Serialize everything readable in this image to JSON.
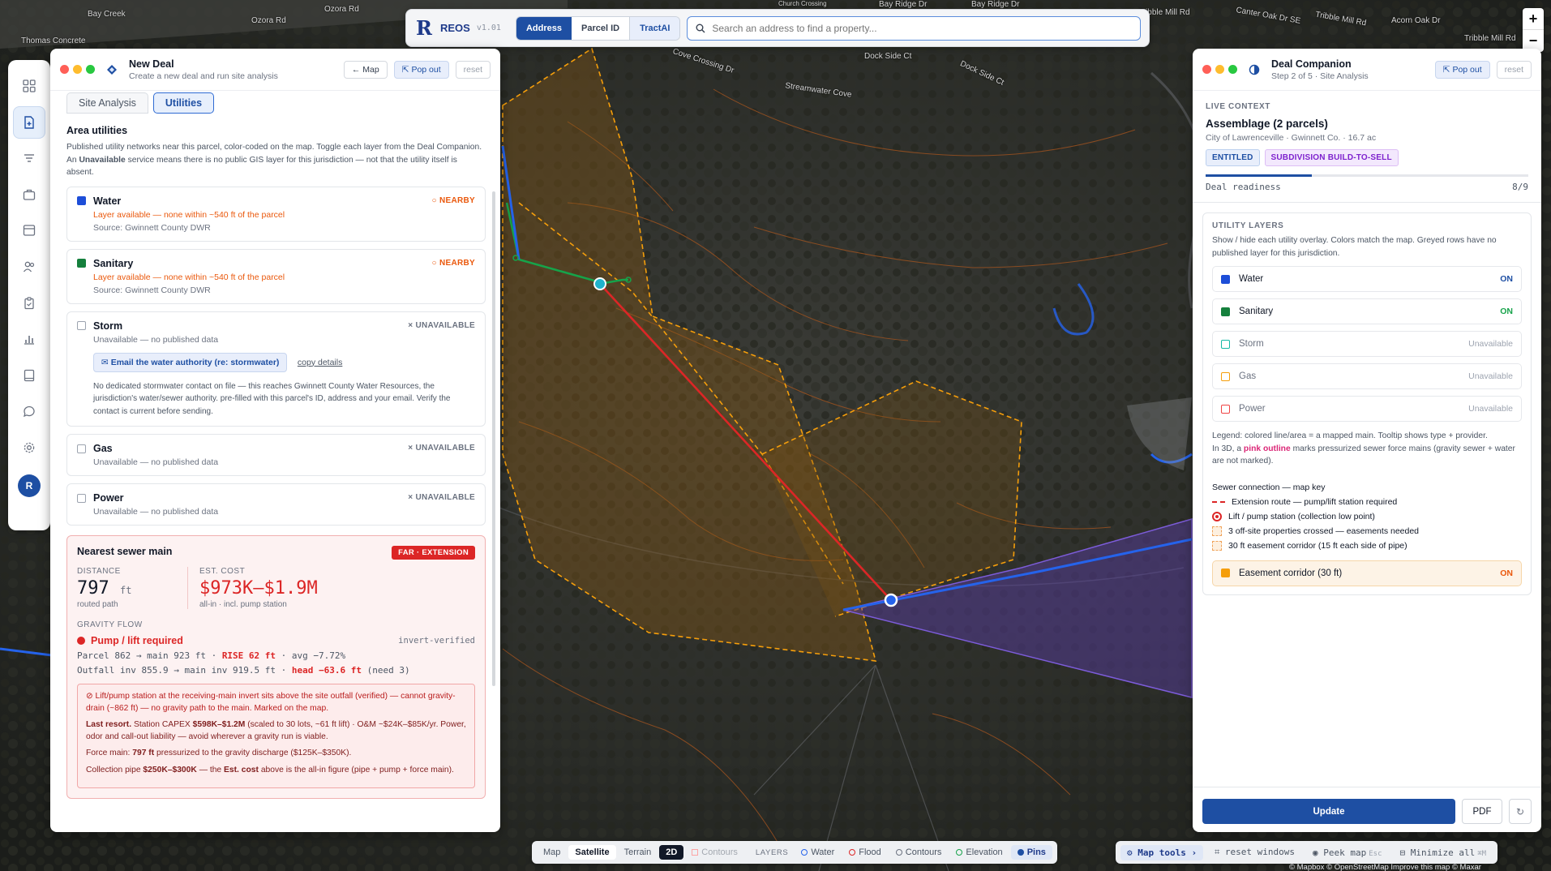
{
  "map": {
    "labels": [
      "Bay Creek",
      "Ozora Rd",
      "Ozora Rd",
      "Thomas Concrete",
      "Cove Crossing Dr",
      "Dock Side Ct",
      "Dock Side Ct",
      "Streamwater Cove",
      "Bay Ridge Dr",
      "Bay Ridge Dr",
      "Tribble Mill Rd",
      "Tribble Mill Rd",
      "Canter Oak Dr SE",
      "Acorn Oak Dr",
      "Tribble Mill Rd",
      "Church Crossing"
    ],
    "zoom_in": "+",
    "zoom_out": "−",
    "attribution": "© Mapbox © OpenStreetMap Improve this map © Maxar"
  },
  "topbar": {
    "logo": "R",
    "brand": "REOS",
    "version": "v1.01",
    "modes": [
      "Address",
      "Parcel ID",
      "TractAI"
    ],
    "search_placeholder": "Search an address to find a property..."
  },
  "rail": {
    "icons": [
      "grid-icon",
      "new-deal-icon",
      "filter-icon",
      "briefcase-icon",
      "inbox-icon",
      "people-icon",
      "clipboard-icon",
      "chart-icon",
      "book-icon",
      "chat-icon",
      "settings-icon"
    ],
    "avatar": "R"
  },
  "left_panel": {
    "title": "New Deal",
    "subtitle": "Create a new deal and run site analysis",
    "map_btn": "← Map",
    "popout_btn": "⇱ Pop out",
    "reset_btn": "reset",
    "tabs": [
      "Site Analysis",
      "Utilities"
    ],
    "section_title": "Area utilities",
    "section_desc_1": "Published utility networks near this parcel, color-coded on the map. Toggle each layer from the Deal Companion. An ",
    "section_desc_bold": "Unavailable",
    "section_desc_2": " service means there is no public GIS layer for this jurisdiction — not that the utility itself is absent.",
    "utilities": [
      {
        "name": "Water",
        "color": "#1d4ed8",
        "tag": "NEARBY",
        "line1": "Layer available — none within ~540 ft of the parcel",
        "line2": "Source: Gwinnett County DWR"
      },
      {
        "name": "Sanitary",
        "color": "#15803d",
        "tag": "NEARBY",
        "line1": "Layer available — none within ~540 ft of the parcel",
        "line2": "Source: Gwinnett County DWR"
      },
      {
        "name": "Storm",
        "tag": "UNAVAILABLE",
        "line1": "Unavailable — no published data",
        "email_btn": "✉ Email the water authority (re: stormwater)",
        "copy_link": "copy details",
        "note": "No dedicated stormwater contact on file — this reaches Gwinnett County Water Resources, the jurisdiction's water/sewer authority. pre-filled with this parcel's ID, address and your email. Verify the contact is current before sending."
      },
      {
        "name": "Gas",
        "tag": "UNAVAILABLE",
        "line1": "Unavailable — no published data"
      },
      {
        "name": "Power",
        "tag": "UNAVAILABLE",
        "line1": "Unavailable — no published data"
      }
    ],
    "sewer": {
      "title": "Nearest sewer main",
      "badge": "FAR · EXTENSION",
      "distance_label": "DISTANCE",
      "distance_value": "797",
      "distance_unit": "ft",
      "distance_sub": "routed path",
      "cost_label": "EST. COST",
      "cost_value": "$973K–$1.9M",
      "cost_sub": "all-in · incl. pump station",
      "gravity_label": "GRAVITY FLOW",
      "gravity_status": "Pump / lift required",
      "gravity_verified": "invert-verified",
      "line1_a": "Parcel 862 → main 923 ft · ",
      "line1_b": "RISE 62 ft",
      "line1_c": " · avg −7.72%",
      "line2_a": "Outfall inv 855.9 → main inv 919.5 ft · ",
      "line2_b": "head −63.6 ft",
      "line2_c": " (need 3)",
      "warn_1": "⊘ Lift/pump station at the receiving-main invert sits above the site outfall (verified) — cannot gravity-drain (~862 ft) — no gravity path to the main. Marked on the map.",
      "warn_2_bold": "Last resort.",
      "warn_2_a": " Station CAPEX ",
      "warn_2_b": "$598K–$1.2M",
      "warn_2_c": " (scaled to 30 lots, ~61 ft lift) · O&M ~$24K–$85K/yr. Power, odor and call-out liability — avoid wherever a gravity run is viable.",
      "warn_3_a": "Force main: ",
      "warn_3_b": "797 ft",
      "warn_3_c": " pressurized to the gravity discharge ($125K–$350K).",
      "warn_4_a": "Collection pipe ",
      "warn_4_b": "$250K–$300K",
      "warn_4_c": " — the ",
      "warn_4_d": "Est. cost",
      "warn_4_e": " above is the all-in figure (pipe + pump + force main)."
    }
  },
  "right_panel": {
    "title": "Deal Companion",
    "subtitle": "Step 2 of 5 · Site Analysis",
    "popout_btn": "⇱ Pop out",
    "reset_btn": "reset",
    "ctx_label": "LIVE CONTEXT",
    "ctx_title": "Assemblage (2 parcels)",
    "ctx_sub": "City of Lawrenceville · Gwinnett Co. · 16.7 ac",
    "pills": [
      "ENTITLED",
      "SUBDIVISION BUILD-TO-SELL"
    ],
    "readiness_label": "Deal readiness",
    "readiness_value": "8/9",
    "readiness_fraction": 0.33,
    "layers_label": "UTILITY LAYERS",
    "layers_desc": "Show / hide each utility overlay. Colors match the map. Greyed rows have no published layer for this jurisdiction.",
    "layers": [
      {
        "name": "Water",
        "color": "#1d4ed8",
        "state": "ON",
        "enabled": true
      },
      {
        "name": "Sanitary",
        "color": "#15803d",
        "state": "ON",
        "enabled": true
      },
      {
        "name": "Storm",
        "color": "#14b8a6",
        "state": "Unavailable",
        "enabled": false
      },
      {
        "name": "Gas",
        "color": "#f59e0b",
        "state": "Unavailable",
        "enabled": false
      },
      {
        "name": "Power",
        "color": "#ef4444",
        "state": "Unavailable",
        "enabled": false
      }
    ],
    "legend_1": "Legend: colored line/area = a mapped main. Tooltip shows type + provider.",
    "legend_2a": "In 3D, a ",
    "legend_2b": "pink outline",
    "legend_2c": " marks pressurized sewer force mains (gravity sewer + water are not marked).",
    "key_title": "Sewer connection — map key",
    "keys": [
      "Extension route — pump/lift station required",
      "Lift / pump station (collection low point)",
      "3 off-site properties crossed — easements needed",
      "30 ft easement corridor (15 ft each side of pipe)"
    ],
    "easement_row": {
      "name": "Easement corridor (30 ft)",
      "state": "ON",
      "color": "#f59e0b"
    },
    "update_btn": "Update",
    "pdf_btn": "PDF",
    "refresh_icon": "↻"
  },
  "bottom_bar": {
    "styles": [
      "Map",
      "Satellite",
      "Terrain",
      "2D"
    ],
    "contours_faded": "Contours",
    "layers_label": "LAYERS",
    "layers": [
      {
        "name": "Water",
        "color": "#2563eb"
      },
      {
        "name": "Flood",
        "color": "#dc2626"
      },
      {
        "name": "Contours",
        "color": "#6b7280"
      },
      {
        "name": "Elevation",
        "color": "#16a34a"
      }
    ],
    "pins": "Pins",
    "tools": [
      "⚙ Map tools ›",
      "⌗ reset windows",
      "◉ Peek map",
      "⊟ Minimize all"
    ],
    "peek_kbd": "Esc",
    "min_kbd": "⌘M"
  }
}
